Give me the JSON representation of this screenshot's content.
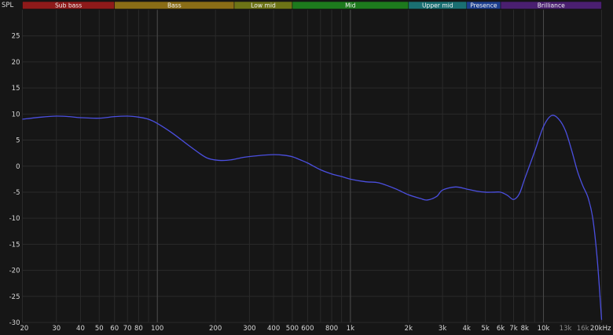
{
  "chart_data": {
    "type": "line",
    "ylabel": "SPL",
    "x_scale": "log",
    "xlim": [
      20,
      20000
    ],
    "ylim": [
      -30,
      30
    ],
    "grid": true,
    "x_ticks": [
      {
        "v": 20,
        "label": "20"
      },
      {
        "v": 30,
        "label": "30"
      },
      {
        "v": 40,
        "label": "40"
      },
      {
        "v": 50,
        "label": "50"
      },
      {
        "v": 60,
        "label": "60"
      },
      {
        "v": 70,
        "label": "70"
      },
      {
        "v": 80,
        "label": "80"
      },
      {
        "v": 100,
        "label": "100"
      },
      {
        "v": 200,
        "label": "200"
      },
      {
        "v": 300,
        "label": "300"
      },
      {
        "v": 400,
        "label": "400"
      },
      {
        "v": 500,
        "label": "500"
      },
      {
        "v": 600,
        "label": "600"
      },
      {
        "v": 800,
        "label": "800"
      },
      {
        "v": 1000,
        "label": "1k"
      },
      {
        "v": 2000,
        "label": "2k"
      },
      {
        "v": 3000,
        "label": "3k"
      },
      {
        "v": 4000,
        "label": "4k"
      },
      {
        "v": 5000,
        "label": "5k"
      },
      {
        "v": 6000,
        "label": "6k"
      },
      {
        "v": 7000,
        "label": "7k"
      },
      {
        "v": 8000,
        "label": "8k"
      },
      {
        "v": 10000,
        "label": "10k"
      },
      {
        "v": 13000,
        "label": "13k",
        "muted": true
      },
      {
        "v": 16000,
        "label": "16k",
        "muted": true
      },
      {
        "v": 20000,
        "label": "20kHz"
      }
    ],
    "y_ticks": [
      {
        "v": 25,
        "label": "25"
      },
      {
        "v": 20,
        "label": "20"
      },
      {
        "v": 15,
        "label": "15"
      },
      {
        "v": 10,
        "label": "10"
      },
      {
        "v": 5,
        "label": "5"
      },
      {
        "v": 0,
        "label": "0"
      },
      {
        "v": -5,
        "label": "-5"
      },
      {
        "v": -10,
        "label": "-10"
      },
      {
        "v": -15,
        "label": "-15"
      },
      {
        "v": -20,
        "label": "-20"
      },
      {
        "v": -25,
        "label": "-25"
      },
      {
        "v": -30,
        "label": "-30"
      }
    ],
    "bands": [
      {
        "label": "Sub bass",
        "from": 20,
        "to": 60,
        "color": "#8e1a1a"
      },
      {
        "label": "Bass",
        "from": 60,
        "to": 250,
        "color": "#8a6d16"
      },
      {
        "label": "Low mid",
        "from": 250,
        "to": 500,
        "color": "#6d7416"
      },
      {
        "label": "Mid",
        "from": 500,
        "to": 2000,
        "color": "#1d7a1d"
      },
      {
        "label": "Upper mid",
        "from": 2000,
        "to": 4000,
        "color": "#1a6f72"
      },
      {
        "label": "Presence",
        "from": 4000,
        "to": 6000,
        "color": "#1d3f8f"
      },
      {
        "label": "Brilliance",
        "from": 6000,
        "to": 20000,
        "color": "#4a1f70"
      }
    ],
    "colors": {
      "background": "#161616",
      "grid_minor": "#2a2a2a",
      "grid_major": "#4a4a4a",
      "tick_text": "#d8d8d8",
      "tick_text_muted": "#8a8a8a",
      "line": "#4b4fe0"
    },
    "series": [
      {
        "x": [
          20,
          25,
          30,
          35,
          40,
          50,
          60,
          70,
          80,
          90,
          100,
          120,
          150,
          180,
          210,
          240,
          280,
          330,
          400,
          450,
          500,
          550,
          600,
          700,
          800,
          900,
          1000,
          1200,
          1400,
          1700,
          2000,
          2300,
          2500,
          2800,
          3000,
          3500,
          4000,
          4500,
          5000,
          5500,
          6000,
          6500,
          7000,
          7500,
          8000,
          9000,
          10000,
          11000,
          12000,
          13000,
          14000,
          15000,
          16000,
          17000,
          18000,
          19000,
          20000
        ],
        "y": [
          9.0,
          9.4,
          9.6,
          9.5,
          9.3,
          9.2,
          9.5,
          9.6,
          9.4,
          9.0,
          8.2,
          6.3,
          3.6,
          1.6,
          1.1,
          1.2,
          1.7,
          2.0,
          2.2,
          2.1,
          1.8,
          1.2,
          0.6,
          -0.7,
          -1.5,
          -2.0,
          -2.5,
          -3.0,
          -3.2,
          -4.3,
          -5.5,
          -6.2,
          -6.5,
          -5.8,
          -4.6,
          -4.0,
          -4.4,
          -4.8,
          -5.0,
          -5.0,
          -5.0,
          -5.6,
          -6.4,
          -5.3,
          -2.4,
          2.8,
          7.6,
          9.7,
          9.0,
          6.8,
          3.0,
          -1.0,
          -3.8,
          -6.0,
          -10.0,
          -18.0,
          -29.5
        ]
      }
    ]
  }
}
